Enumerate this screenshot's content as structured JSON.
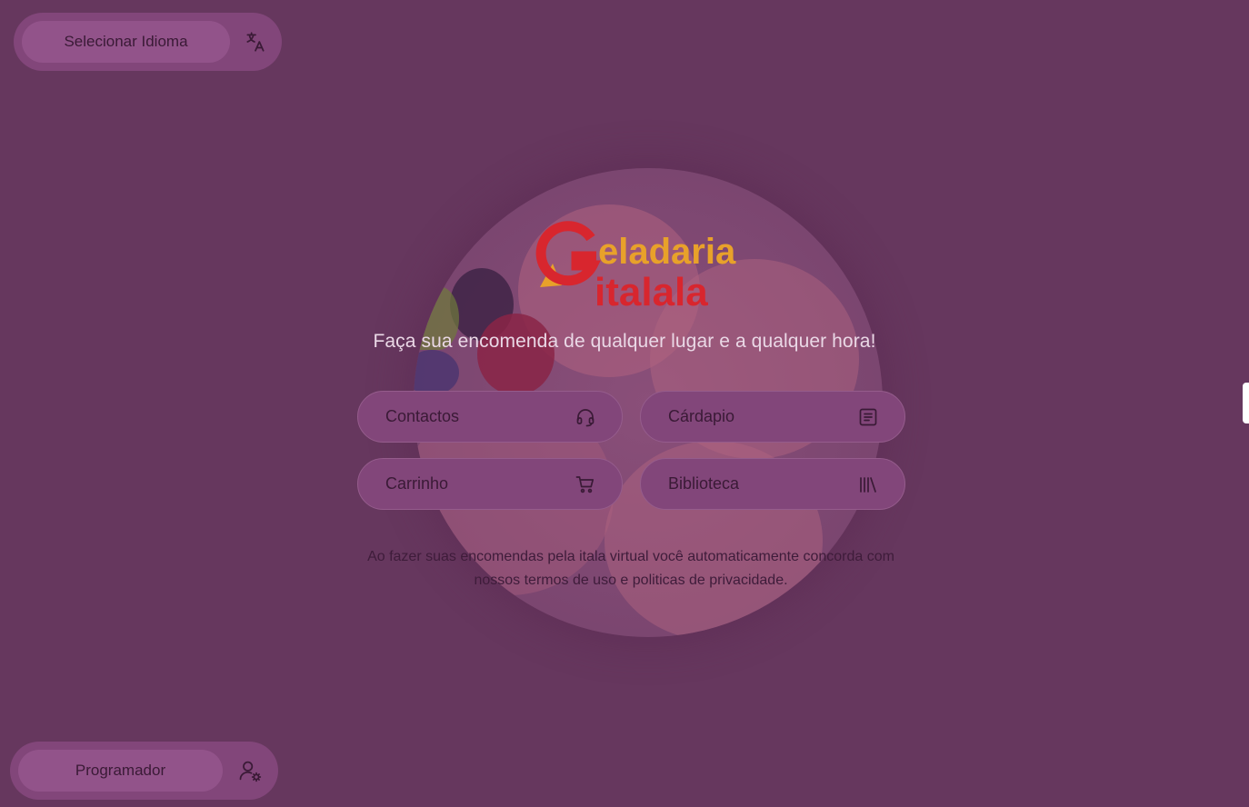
{
  "language": {
    "label": "Selecionar Idioma",
    "icon": "translate-icon"
  },
  "developer": {
    "label": "Programador",
    "icon": "user-settings-icon"
  },
  "logo": {
    "line1": "eladaria",
    "line2": "italala",
    "initial": "G"
  },
  "tagline": "Faça sua encomenda de qualquer lugar e a qualquer hora!",
  "menu": {
    "contactos": {
      "label": "Contactos",
      "icon": "headset-icon"
    },
    "cardapio": {
      "label": "Cárdapio",
      "icon": "menu-list-icon"
    },
    "carrinho": {
      "label": "Carrinho",
      "icon": "cart-icon"
    },
    "biblioteca": {
      "label": "Biblioteca",
      "icon": "library-icon"
    }
  },
  "terms": {
    "line1": "Ao fazer suas encomendas pela itala virtual você automaticamente concorda com",
    "line2": "nossos termos de uso e politicas de privacidade."
  },
  "colors": {
    "background": "#66375e",
    "logo_red": "#d8262e",
    "logo_orange": "#e8a12a"
  }
}
